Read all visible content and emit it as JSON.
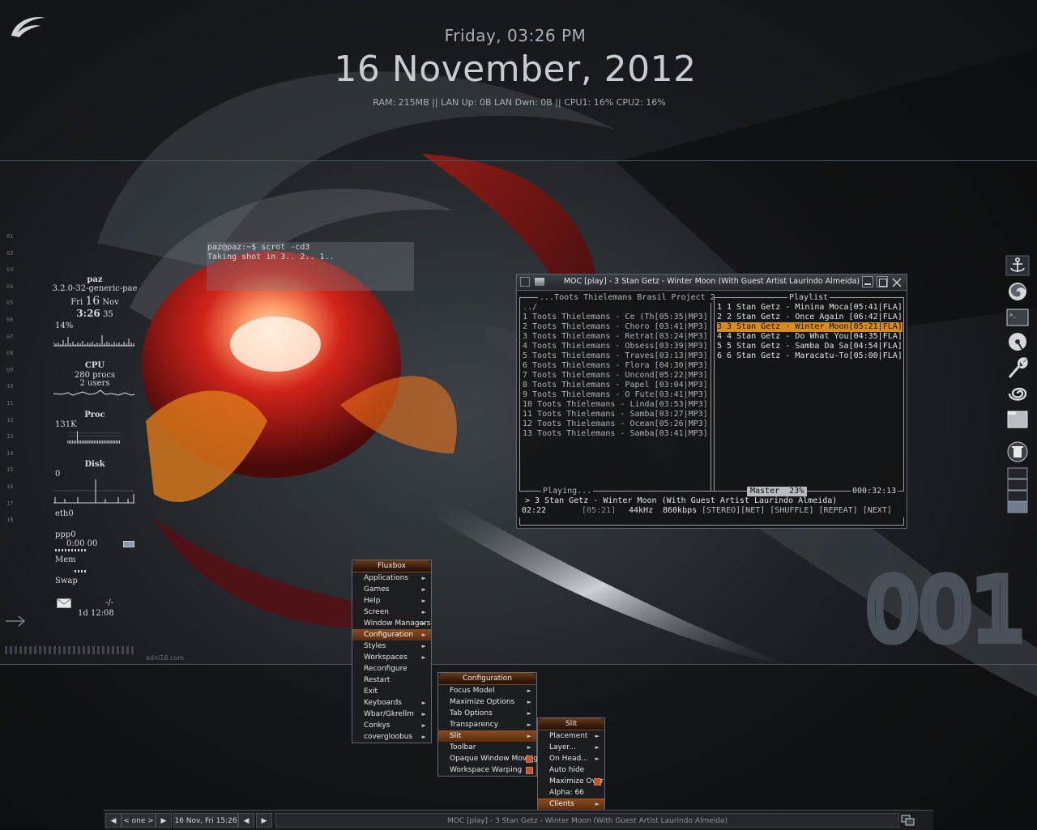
{
  "clock": {
    "day_time": "Friday, 03:26 PM",
    "date": "16 November, 2012",
    "stats": "RAM: 215MB || LAN Up: 0B LAN Dwn: 0B || CPU1: 16% CPU2: 16%"
  },
  "conky": {
    "user": "paz",
    "kernel": "3.2.0-32-generic-pae",
    "day": "Fri",
    "daynum": "16",
    "month": "Nov",
    "time": "3:26",
    "seconds": "35",
    "cpu_percent": "14%",
    "cpu_label": "CPU",
    "procs": "280 procs",
    "users": "2 users",
    "proc_label": "Proc",
    "mem_value": "131K",
    "disk_label": "Disk",
    "disk_value": "0",
    "eth": "eth0",
    "ppp": "ppp0",
    "ppp_time": "0:00 00",
    "mem_label": "Mem",
    "swap_label": "Swap",
    "mail_count": "-/-",
    "uptime": "1d 12:08",
    "site": "adni18.com",
    "line_numbers": [
      "01",
      "02",
      "03",
      "04",
      "05",
      "06",
      "07",
      "08",
      "09",
      "10",
      "11",
      "12",
      "13",
      "14",
      "15",
      "16",
      "17",
      "18"
    ]
  },
  "terminal": {
    "line1": "paz@paz:~$ scrot -cd3",
    "line2": "Taking shot in 3.. 2.. 1.."
  },
  "moc": {
    "title": "MOC [play] - 3 Stan Getz - Winter Moon (With Guest Artist Laurindo Almeida)",
    "left_header": "...Toots Thielemans Brasil Project 2",
    "up_dir": "../",
    "left_files": [
      "1 Toots Thielemans - Ce (Th[05:35|MP3]",
      "2 Toots Thielemans - Choro [03:41|MP3]",
      "3 Toots Thielemans - Retrat[03:24|MP3]",
      "4 Toots Thielemans - Obsess[03:39|MP3]",
      "5 Toots Thielemans - Traves[03:13|MP3]",
      "6 Toots Thielemans - Flora [04:30|MP3]",
      "7 Toots Thielemans - Uncond[05:22|MP3]",
      "8 Toots Thielemans - Papel [03:04|MP3]",
      "9 Toots Thielemans - O Fute[03:41|MP3]",
      "10 Toots Thielemans - Linda[03:53|MP3]",
      "11 Toots Thielemans - Samba[03:27|MP3]",
      "12 Toots Thielemans - Ocean[05:26|MP3]",
      "13 Toots Thielemans - Samba[03:41|MP3]"
    ],
    "playlist_header": "Playlist",
    "playlist": [
      "1 1 Stan Getz - Minina Moca[05:41|FLA]",
      "2 2 Stan Getz - Once Again [06:42|FLA]",
      "3 3 Stan Getz - Winter Moon[05:21|FLA]",
      "4 4 Stan Getz - Do What You[04:35|FLA]",
      "5 5 Stan Getz - Samba Da Sa[04:54|FLA]",
      "6 6 Stan Getz - Maracatu-To[05:00|FLA]"
    ],
    "playlist_selected_index": 2,
    "playing_label": "Playing...",
    "master": "Master  23%",
    "total_time": "000:32:13",
    "now_playing": "> 3 Stan Getz - Winter Moon (With Guest Artist Laurindo Almeida)",
    "elapsed": "02:22",
    "duration": "[05:21]",
    "rate": "44kHz",
    "bitrate": "860kbps",
    "flags": "[STEREO][NET] [SHUFFLE] [REPEAT] [NEXT]"
  },
  "menus": {
    "fluxbox": {
      "title": "Fluxbox",
      "items": [
        "Applications",
        "Games",
        "Help",
        "Screen",
        "Window Managers",
        "Configuration",
        "Styles",
        "Workspaces",
        "Reconfigure",
        "Restart",
        "Exit",
        "Keyboards",
        "Wbar/Gkrellm",
        "Conkys",
        "covergloobus"
      ],
      "has_submenu": [
        true,
        true,
        true,
        true,
        true,
        true,
        true,
        true,
        false,
        false,
        false,
        true,
        true,
        true,
        true
      ],
      "selected_index": 5
    },
    "configuration": {
      "title": "Configuration",
      "items": [
        "Focus Model",
        "Maximize Options",
        "Tab Options",
        "Transparency",
        "Slit",
        "Toolbar",
        "Opaque Window Moving",
        "Workspace Warping"
      ],
      "kind": [
        "sub",
        "sub",
        "sub",
        "sub",
        "sub",
        "sub",
        "check",
        "check"
      ],
      "selected_index": 4
    },
    "slit": {
      "title": "Slit",
      "items": [
        "Placement",
        "Layer...",
        "On Head...",
        "Auto hide",
        "Maximize Over",
        "Alpha: 66",
        "Clients"
      ],
      "kind": [
        "sub",
        "sub",
        "sub",
        "none",
        "check",
        "none",
        "sub"
      ],
      "selected_index": 6
    }
  },
  "workspace_number": "001",
  "toolbar": {
    "prev": "◀",
    "workspace": "< one >",
    "next": "▶",
    "clock": "16 Nov, Fri 15:26",
    "task": "MOC [play] - 3 Stan Getz - Winter Moon (With Guest Artist Laurindo Almeida)"
  },
  "dock_icons": [
    "anchor-icon",
    "firefox-icon",
    "terminal-icon",
    "disk-utility-icon",
    "wrench-icon",
    "spiral-icon",
    "file-manager-icon",
    "trash-icon",
    "workspace-pager-icon"
  ],
  "colors": {
    "accent": "#d98c1e",
    "menu_selected": "#8a4d22"
  }
}
